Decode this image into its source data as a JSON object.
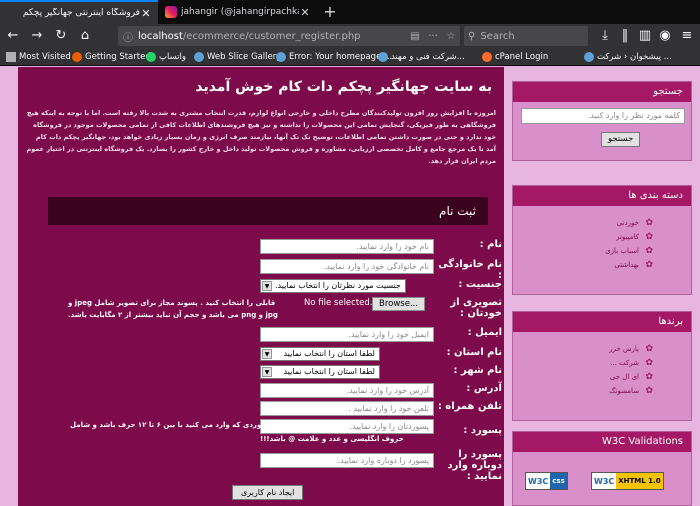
{
  "browser": {
    "tabs": [
      {
        "title": "فروشگاه اینترنتی جهانگیر پچکم",
        "close": "✕"
      },
      {
        "title": "jahangir (@jahangirpachkam) • Ins",
        "close": "✕"
      }
    ],
    "new_tab": "+",
    "url_host": "localhost",
    "url_path": "/ecommerce/customer_register.php",
    "search_placeholder": "Search",
    "bookmarks": [
      "Most Visited",
      "Getting Started",
      "واتساپ",
      "Web Slice Gallery",
      "Error: Your homepage ...",
      "شرکت فنی و مهند...",
      "cPanel Login",
      "پیشخوان ‹ شرکت ..."
    ],
    "colors": {
      "brand": "#7d0a4a",
      "sidebar": "#d88fca",
      "heading": "#a51866"
    }
  },
  "main": {
    "welcome": "به سایت جهانگیر پچکم دات کام خوش آمدید",
    "intro": "امروزه با افزایش روز افزون تولیدکنندگان مطرح داخلی و خارجی انواع لوازم، قدرت انتخاب مشتری به شدت بالا رفته است. اما با توجه به اینکه هیچ فروشگاهی به طور فیزیکی، گنجایش تمامی این محصولات را نداشته و نیز هیچ فروشندهای اطلاعات کافی از تمامی محصولات موجود در فروشگاه خود ندارد و حتی در صورت داشتن تمامی اطلاعات، توضیح تک تک آنها، نیازمند صرف انرژی و زمان بسیار زیادی خواهد بود، جهانگیر پچکم دات کام آمد تا یک مرجع جامع و کامل تخصصی ارزیابی، مشاوره و فروش محصولات تولید داخل و خارج کشور را بسازد. یک فروشگاه اینترنتی در اختیار عموم مردم ایران قرار دهد.",
    "register": {
      "title": "ثبت نام",
      "name_label": "نام :",
      "name_ph": "نام خود را وارد نمایید.",
      "family_label": "نام خانوادگی :",
      "family_ph": "نام خانوادگی خود را وارد نمایید.",
      "gender_label": "جنسیت :",
      "gender_value": "جنسیت مورد نظرتان را انتخاب نمایید.",
      "image_label": "تصویری از خودتان :",
      "browse": "Browse...",
      "nofile": "No file selected.",
      "image_hint1": "قابلی را انتخاب کنید . پسوند مجاز برای تصویر شامل jpeg و",
      "image_hint2": "jpg و png می باشد و حجم آن نباید بیشتر از ۲ مگابایت باشد.",
      "email_label": "ایمیل :",
      "email_ph": "ایمیل خود را وارد نمایید.",
      "state_label": "نام استان :",
      "state_value": "لطفا استان را انتخاب نمایید",
      "city_label": "نام شهر :",
      "city_value": "لطفا استان را انتخاب نمایید",
      "address_label": "آدرس :",
      "address_ph": "آدرس خود را وارد نمایید.",
      "phone_label": "تلفن همراه :",
      "phone_ph": "تلفن خود را وارد نمایید .",
      "password_label": "پسورد :",
      "password_ph": "پسوردتان را وارد نمایید.",
      "password_hint1": "پسوردی که وارد می کنید با بین ۶ تا ۱۲ حرف باشد و شامل",
      "password_hint2": "حروف انگلیسی و عدد و علامت @ باشد!!!",
      "repassword_label": "پسورد را دوباره وارد نمایید :",
      "repassword_ph": "پسورد را دوباره وارد نمایید.",
      "submit": "ایجاد نام کاربری"
    }
  },
  "sidebar": {
    "search": {
      "title": "جستجو",
      "placeholder": "کلمه مورد نظر را وارد کنید.",
      "button": "جستجو"
    },
    "categories": {
      "title": "دسته بندی ها",
      "items": [
        "خوردنی",
        "کامپیوتر",
        "اسباب بازی",
        "بهداشتی"
      ]
    },
    "brands": {
      "title": "برندها",
      "items": [
        "پارس خزر",
        "شرکت ...",
        "ای ال جی",
        "سامسونگ"
      ]
    },
    "w3c": {
      "title": "W3C Validations",
      "badge1_left": "W3C",
      "badge1_right": "css",
      "badge2_left": "W3C",
      "badge2_right": "XHTML 1.0"
    }
  }
}
